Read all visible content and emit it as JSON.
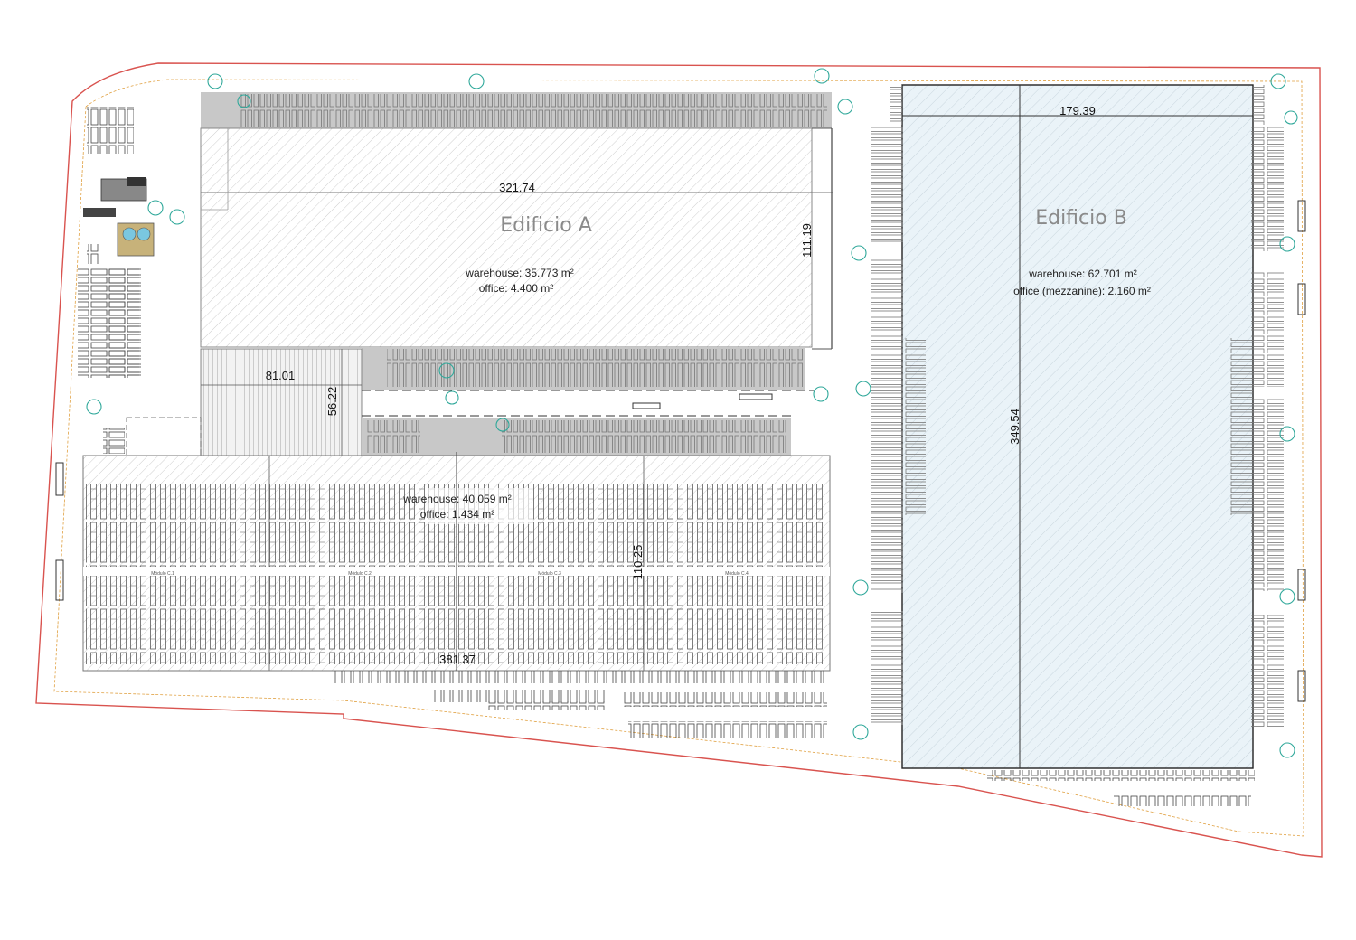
{
  "buildings": {
    "a": {
      "name": "Edificio A",
      "warehouse": "warehouse: 35.773 m²",
      "office": "office: 4.400 m²",
      "dim_length": "321.74",
      "dim_depth": "111.19"
    },
    "b": {
      "name": "Edificio B",
      "warehouse": "warehouse: 62.701 m²",
      "office": "office (mezzanine): 2.160 m²",
      "dim_width": "179.39",
      "dim_length": "349.54"
    },
    "c": {
      "warehouse": "warehouse: 40.059 m²",
      "office": "office: 1.434 m²",
      "dim_length": "381.37",
      "dim_depth": "110.25",
      "modules": [
        "Módulo C.1",
        "Módulo C.2",
        "Módulo C.3",
        "Módulo C.4"
      ]
    },
    "connector": {
      "dim_width": "81.01",
      "dim_depth": "56.22"
    }
  },
  "colors": {
    "boundary": "#d9534f",
    "road_edge": "#e0a040",
    "hatch": "#cfcfcf",
    "building_b_fill": "#eaf3f8",
    "dock": "#9a9a9a",
    "tree": "#2fa89a",
    "label": "#8a8a8a"
  }
}
